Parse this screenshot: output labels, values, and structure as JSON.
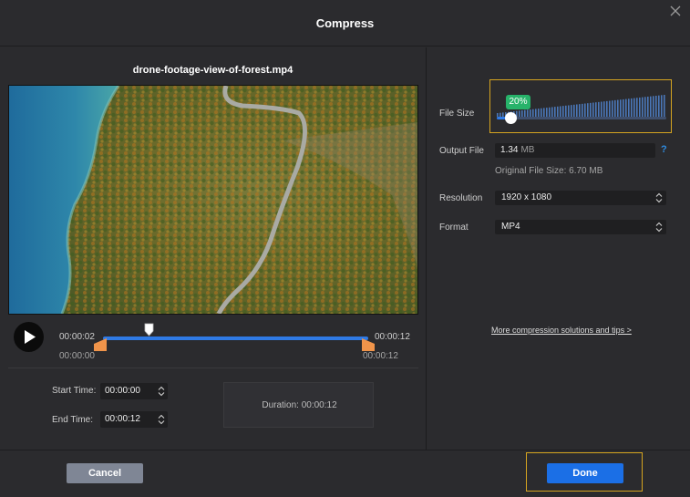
{
  "dialog": {
    "title": "Compress",
    "close_icon": "close-icon"
  },
  "video": {
    "filename": "drone-footage-view-of-forest.mp4",
    "play_icon": "play-icon",
    "current_time": "00:00:02",
    "total_time": "00:00:12",
    "trim_start": "00:00:00",
    "trim_end": "00:00:12",
    "playhead_fraction": 0.17
  },
  "trim": {
    "start_label": "Start Time:",
    "start_value": "00:00:00",
    "end_label": "End Time:",
    "end_value": "00:00:12",
    "duration_label": "Duration:",
    "duration_value": "00:00:12"
  },
  "settings": {
    "file_size_label": "File Size",
    "file_size_percent": "20%",
    "file_size_fraction": 0.2,
    "output_label": "Output File",
    "output_value": "1.34",
    "output_unit": "MB",
    "help_label": "?",
    "original_size": "Original File Size: 6.70 MB",
    "resolution_label": "Resolution",
    "resolution_value": "1920 x 1080",
    "format_label": "Format",
    "format_value": "MP4",
    "tips_link": "More compression solutions and tips >"
  },
  "footer": {
    "cancel_label": "Cancel",
    "done_label": "Done"
  },
  "colors": {
    "accent": "#1b6fe6",
    "highlight_border": "#d6a520",
    "badge": "#27b36a",
    "trim_handle": "#f0944a"
  }
}
